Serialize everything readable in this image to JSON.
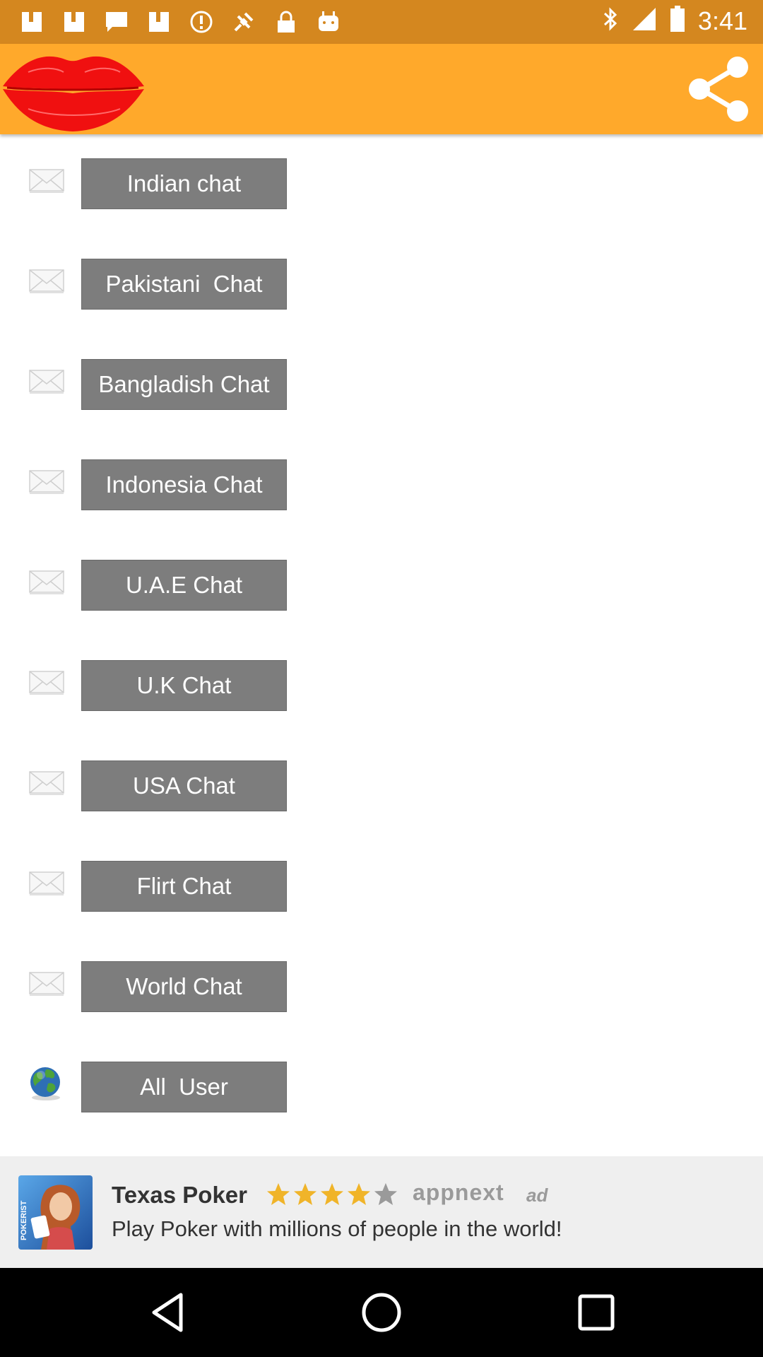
{
  "status_bar": {
    "time": "3:41",
    "icons": [
      "image-icon",
      "image-icon",
      "message-icon",
      "image-icon",
      "alert-icon",
      "gps-icon",
      "lock-icon",
      "android-icon"
    ],
    "right_icons": [
      "bluetooth-icon",
      "signal-icon",
      "battery-icon"
    ]
  },
  "app_bar": {
    "logo": "lips-icon",
    "share": "share-icon",
    "background": "#ffa92b",
    "status_color": "#d4871f"
  },
  "chats": [
    {
      "label": "Indian chat",
      "icon": "mail-icon"
    },
    {
      "label": "Pakistani  Chat",
      "icon": "mail-icon"
    },
    {
      "label": "Bangladish Chat",
      "icon": "mail-icon"
    },
    {
      "label": "Indonesia Chat",
      "icon": "mail-icon"
    },
    {
      "label": "U.A.E Chat",
      "icon": "mail-icon"
    },
    {
      "label": "U.K Chat",
      "icon": "mail-icon"
    },
    {
      "label": "USA Chat",
      "icon": "mail-icon"
    },
    {
      "label": "Flirt Chat",
      "icon": "mail-icon"
    },
    {
      "label": "World Chat",
      "icon": "mail-icon"
    },
    {
      "label": "All  User",
      "icon": "globe-icon"
    }
  ],
  "ad": {
    "title": "Texas Poker",
    "rating": 4.5,
    "rating_max": 5,
    "brand": "appnext",
    "tag": "ad",
    "description": "Play Poker with millions of people in the world!",
    "image_text": "POKERIST"
  },
  "nav": [
    "back-icon",
    "home-icon",
    "recents-icon"
  ]
}
